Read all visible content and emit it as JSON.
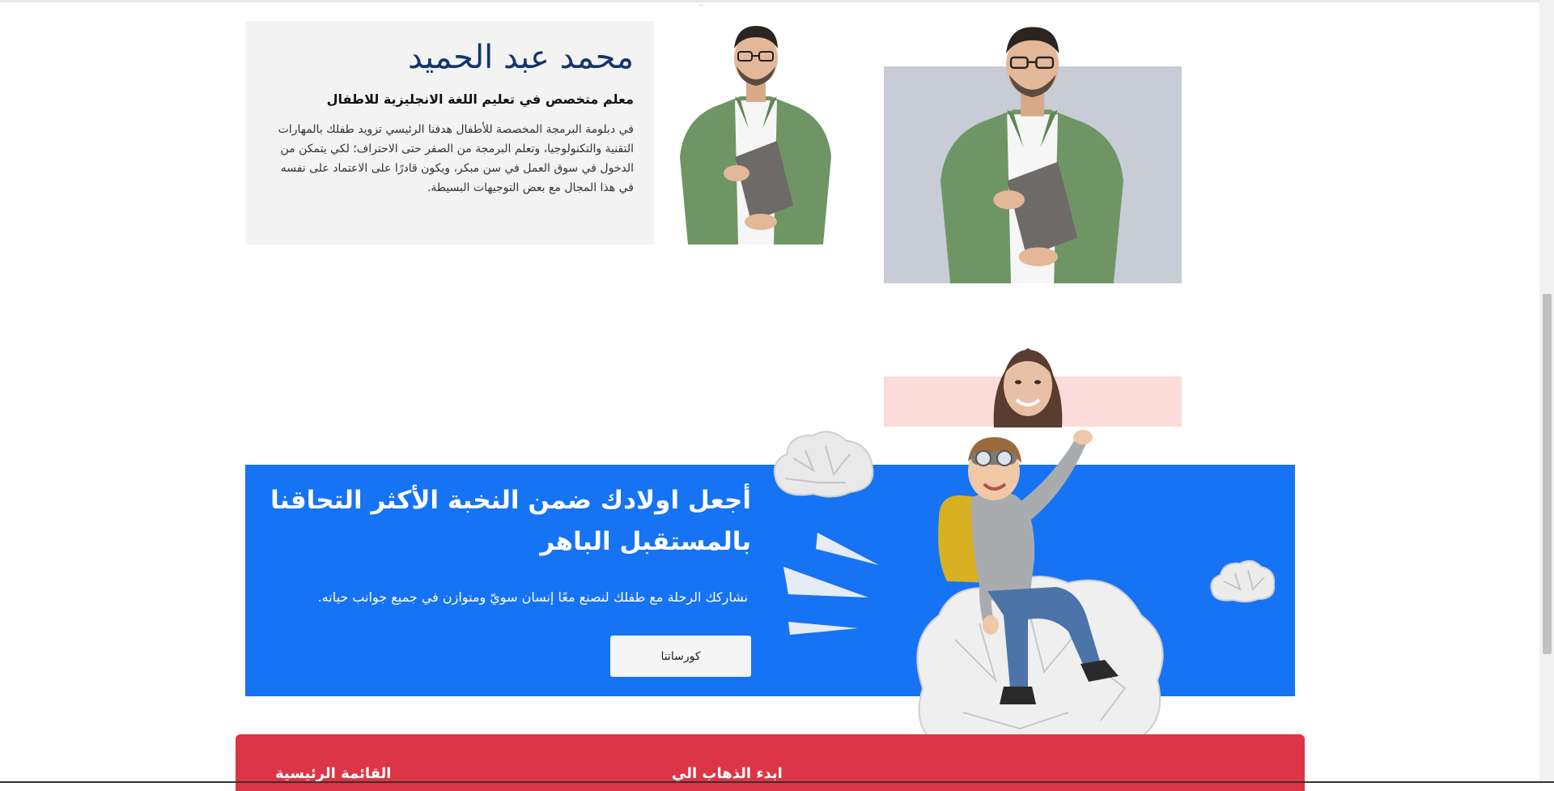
{
  "instructor": {
    "name": "محمد عبد الحميد",
    "role": "معلم متخصص في تعليم اللغة الانجليزية للاطفال",
    "bio": "في دبلومة البرمجة المخصصة للأطفال هدفنا الرئيسي تزويد طفلك بالمهارات التقنية والتكنولوجيا، وتعلم البرمجة من الصفر حتى الاحتراف؛ لكي يتمكن من الدخول في سوق العمل في سن مبكر، ويكون قادرًا على الاعتماد على نفسه في هذا المجال مع بعض التوجيهات البسيطة."
  },
  "cta": {
    "title": "أجعل اولادك ضمن النخبة الأكثر التحاقنا بالمستقبل الباهر",
    "subtitle": "نشاركك الرحلة مع طفلك لنصنع معًا إنسان سويّ ومتوازن في جميع جوانب حياته.",
    "button_label": "كورساتنا"
  },
  "footer": {
    "heading_main_menu": "القائمة الرئيسية",
    "heading_second": "ابدء الذهاب الي"
  },
  "colors": {
    "blue": "#1673f4",
    "red": "#dc3545",
    "navy": "#15356b",
    "card_gray": "#f3f3f3"
  },
  "icons": [
    "person-photo",
    "cloud-icon",
    "paper-plane-icon",
    "boy-on-cloud-illustration"
  ]
}
